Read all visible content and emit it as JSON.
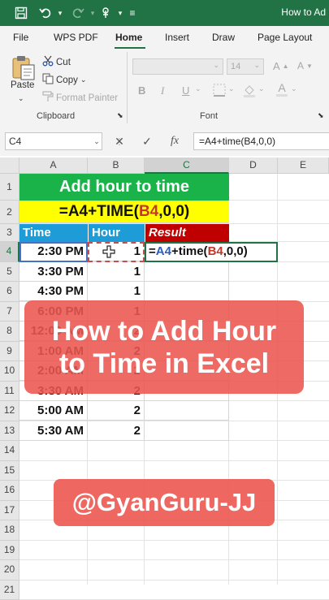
{
  "window": {
    "title": "How to Ad"
  },
  "quick_access": {
    "icons": [
      "save-icon",
      "undo-icon",
      "redo-icon",
      "touch-mode-icon",
      "customize-icon"
    ]
  },
  "tabs": [
    "File",
    "WPS PDF",
    "Home",
    "Insert",
    "Draw",
    "Page Layout"
  ],
  "active_tab": "Home",
  "ribbon": {
    "clipboard": {
      "paste": "Paste",
      "cut": "Cut",
      "copy": "Copy",
      "format_painter": "Format Painter",
      "group_label": "Clipboard"
    },
    "font": {
      "size": "14",
      "bold": "B",
      "italic": "I",
      "underline": "U",
      "font_color": "A",
      "group_label": "Font"
    }
  },
  "formula_bar": {
    "name_box": "C4",
    "cancel": "✕",
    "enter": "✓",
    "fx": "fx",
    "formula": "=A4+time(B4,0,0)"
  },
  "sheet": {
    "columns": [
      "A",
      "B",
      "C",
      "D",
      "E"
    ],
    "selected_column": "C",
    "rows": [
      "1",
      "2",
      "3",
      "4",
      "5",
      "6",
      "7",
      "8",
      "9",
      "10",
      "11",
      "12",
      "13",
      "14",
      "15",
      "16",
      "17",
      "18",
      "19",
      "20",
      "21"
    ],
    "selected_row": "4",
    "title_banner": "Add hour to time",
    "formula_banner": {
      "p1": "=A4+TIME(",
      "p2": "B4",
      "p3": ",0,0)"
    },
    "headers": {
      "time": "Time",
      "hour": "Hour",
      "result": "Result"
    },
    "data": [
      {
        "time": "2:30 PM",
        "hour": "1"
      },
      {
        "time": "3:30 PM",
        "hour": "1"
      },
      {
        "time": "4:30 PM",
        "hour": "1"
      },
      {
        "time": "6:00 PM",
        "hour": "1"
      },
      {
        "time": "12:00 AM",
        "hour": "2"
      },
      {
        "time": "1:00 AM",
        "hour": "2"
      },
      {
        "time": "2:00 AM",
        "hour": "2"
      },
      {
        "time": "3:30 AM",
        "hour": "2"
      },
      {
        "time": "5:00 AM",
        "hour": "2"
      },
      {
        "time": "5:30 AM",
        "hour": "2"
      }
    ],
    "editing_cell": {
      "p1": "=",
      "p2": "A4",
      "p3": "+time(",
      "p4": "B4",
      "p5": ",0,0)"
    }
  },
  "overlay": {
    "line1": "How to Add Hour",
    "line2": "to Time in Excel"
  },
  "credit": "@GyanGuru-JJ",
  "colors": {
    "excel_green": "#217346",
    "banner_green": "#19b34a",
    "banner_yellow": "#ffff00",
    "header_blue": "#1e9cd8",
    "result_red": "#c00000",
    "overlay_red": "#ec5650"
  }
}
